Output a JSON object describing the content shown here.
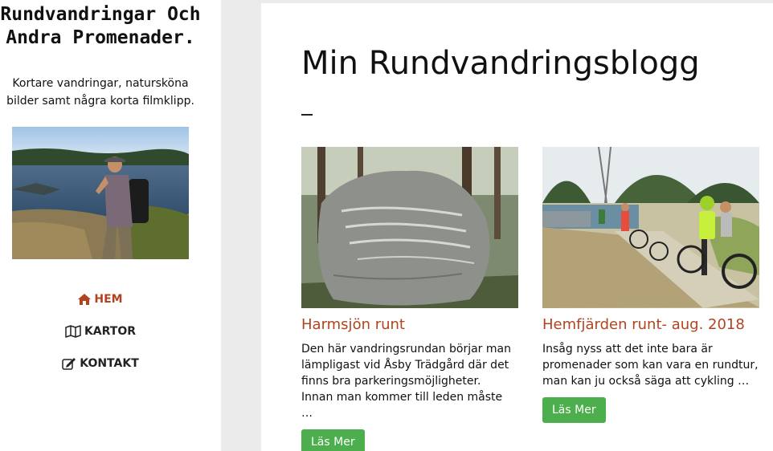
{
  "site": {
    "title": "Rundvandringar Och Andra Promenader.",
    "description": "Kortare vandringar, natursköna bilder samt några korta filmklipp."
  },
  "nav": {
    "items": [
      {
        "label": "HEM",
        "icon": "home-icon",
        "active": true
      },
      {
        "label": "KARTOR",
        "icon": "map-icon",
        "active": false
      },
      {
        "label": "KONTAKT",
        "icon": "edit-icon",
        "active": false
      }
    ]
  },
  "main": {
    "title": "Min Rundvandringsblogg",
    "posts": [
      {
        "title": "Harmsjön runt",
        "excerpt": "Den här vandringsrundan börjar man lämpligast vid Åsby Trädgård där det finns bra parkeringsmöjligheter. Innan man kommer till leden måste …",
        "button": "Läs Mer"
      },
      {
        "title": "Hemfjärden runt- aug. 2018",
        "excerpt": "Insåg nyss att det inte bara är promenader som kan vara en rundtur, man kan ju också säga att cykling …",
        "button": "Läs Mer"
      }
    ]
  },
  "colors": {
    "accent": "#b1441f",
    "button": "#4cae4c",
    "background": "#ebebeb"
  }
}
